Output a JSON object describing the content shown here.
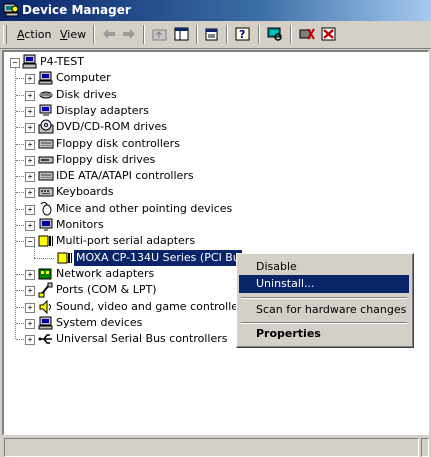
{
  "window": {
    "title": "Device Manager"
  },
  "menu": {
    "action": "Action",
    "view": "View"
  },
  "toolbar": {
    "buttons": [
      "back-icon",
      "forward-icon",
      "up-icon",
      "properties-icon",
      "help-icon",
      "scan-icon",
      "uninstall-icon",
      "disable-icon"
    ]
  },
  "tree": {
    "root": "P4-TEST",
    "items": [
      {
        "label": "Computer",
        "icon": "computer-icon",
        "state": "collapsed"
      },
      {
        "label": "Disk drives",
        "icon": "disk-icon",
        "state": "collapsed"
      },
      {
        "label": "Display adapters",
        "icon": "display-icon",
        "state": "collapsed"
      },
      {
        "label": "DVD/CD-ROM drives",
        "icon": "cdrom-icon",
        "state": "collapsed"
      },
      {
        "label": "Floppy disk controllers",
        "icon": "controller-icon",
        "state": "collapsed"
      },
      {
        "label": "Floppy disk drives",
        "icon": "floppy-icon",
        "state": "collapsed"
      },
      {
        "label": "IDE ATA/ATAPI controllers",
        "icon": "controller-icon",
        "state": "collapsed"
      },
      {
        "label": "Keyboards",
        "icon": "keyboard-icon",
        "state": "collapsed"
      },
      {
        "label": "Mice and other pointing devices",
        "icon": "mouse-icon",
        "state": "collapsed"
      },
      {
        "label": "Monitors",
        "icon": "monitor-icon",
        "state": "collapsed"
      },
      {
        "label": "Multi-port serial adapters",
        "icon": "serial-icon",
        "state": "expanded"
      },
      {
        "label": "Network adapters",
        "icon": "network-icon",
        "state": "collapsed"
      },
      {
        "label": "Ports (COM & LPT)",
        "icon": "port-icon",
        "state": "collapsed"
      },
      {
        "label": "Sound, video and game controllers",
        "icon": "sound-icon",
        "state": "collapsed"
      },
      {
        "label": "System devices",
        "icon": "system-icon",
        "state": "collapsed"
      },
      {
        "label": "Universal Serial Bus controllers",
        "icon": "usb-icon",
        "state": "collapsed"
      }
    ],
    "selected_child": "MOXA CP-134U Series (PCI Bu"
  },
  "context_menu": {
    "items": [
      {
        "label": "Disable",
        "highlighted": false,
        "bold": false
      },
      {
        "label": "Uninstall...",
        "highlighted": true,
        "bold": false
      },
      {
        "label": "Scan for hardware changes",
        "highlighted": false,
        "bold": false
      },
      {
        "label": "Properties",
        "highlighted": false,
        "bold": true
      }
    ]
  },
  "colors": {
    "selection": "#0a246a",
    "face": "#d4d0c8",
    "title_start": "#0a246a",
    "title_end": "#a6caf0"
  }
}
